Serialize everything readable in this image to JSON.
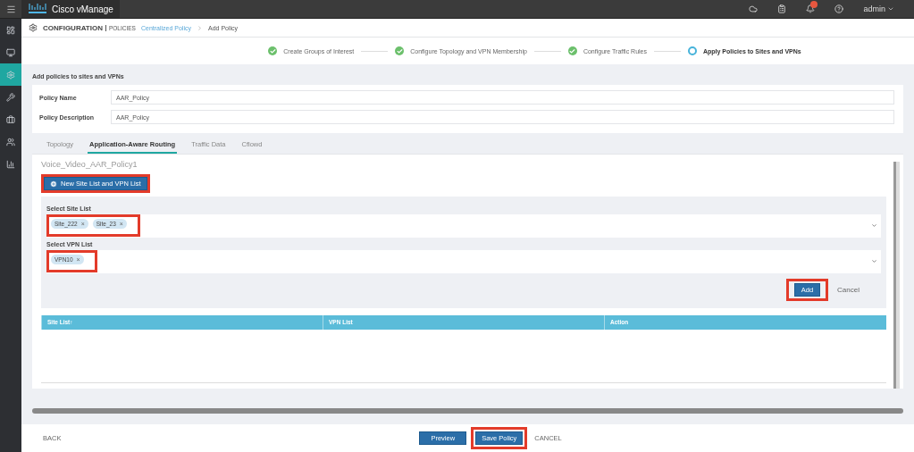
{
  "app": {
    "title": "Cisco vManage"
  },
  "user_menu": {
    "label": "admin"
  },
  "sidebar": {
    "items": [
      {
        "selected": false
      },
      {
        "selected": false
      },
      {
        "selected": true
      },
      {
        "selected": false
      },
      {
        "selected": false
      },
      {
        "selected": false
      },
      {
        "selected": false
      }
    ]
  },
  "header": {
    "section": "CONFIGURATION",
    "subsection": "POLICIES",
    "breadcrumb": [
      "Centralized Policy",
      "Add Policy"
    ]
  },
  "steps": [
    {
      "label": "Create Groups of Interest",
      "completed": true
    },
    {
      "label": "Configure Topology and VPN Membership",
      "completed": true
    },
    {
      "label": "Configure Traffic Rules",
      "completed": true
    },
    {
      "label": "Apply Policies to Sites and VPNs",
      "completed": false
    }
  ],
  "page_title": "Add policies to sites and VPNs",
  "fields": [
    {
      "label": "Policy Name",
      "value": "AAR_Policy"
    },
    {
      "label": "Policy Description",
      "value": "AAR_Policy"
    }
  ],
  "tabs": [
    {
      "label": "Topology",
      "selected": false
    },
    {
      "label": "Application-Aware Routing",
      "selected": true
    },
    {
      "label": "Traffic Data",
      "selected": false
    },
    {
      "label": "Cflowd",
      "selected": false
    }
  ],
  "policy_title": "Voice_Video_AAR_Policy1",
  "new_button": {
    "label": "New Site List and VPN List",
    "highlighted": true
  },
  "selects": [
    {
      "label": "Select Site List",
      "chips": [
        "Site_222",
        "Site_23"
      ],
      "highlighted": true
    },
    {
      "label": "Select VPN List",
      "chips": [
        "VPN10"
      ],
      "highlighted": true
    }
  ],
  "chip_remove": "×",
  "form_actions": {
    "add": {
      "label": "Add",
      "highlighted": true
    },
    "cancel": "Cancel"
  },
  "table": {
    "columns": [
      "Site List↑",
      "VPN List",
      "Action"
    ]
  },
  "footer": {
    "back": "BACK",
    "preview": {
      "label": "Preview",
      "highlighted": false
    },
    "save": {
      "label": "Save Policy",
      "highlighted": true
    },
    "cancel": "CANCEL"
  }
}
